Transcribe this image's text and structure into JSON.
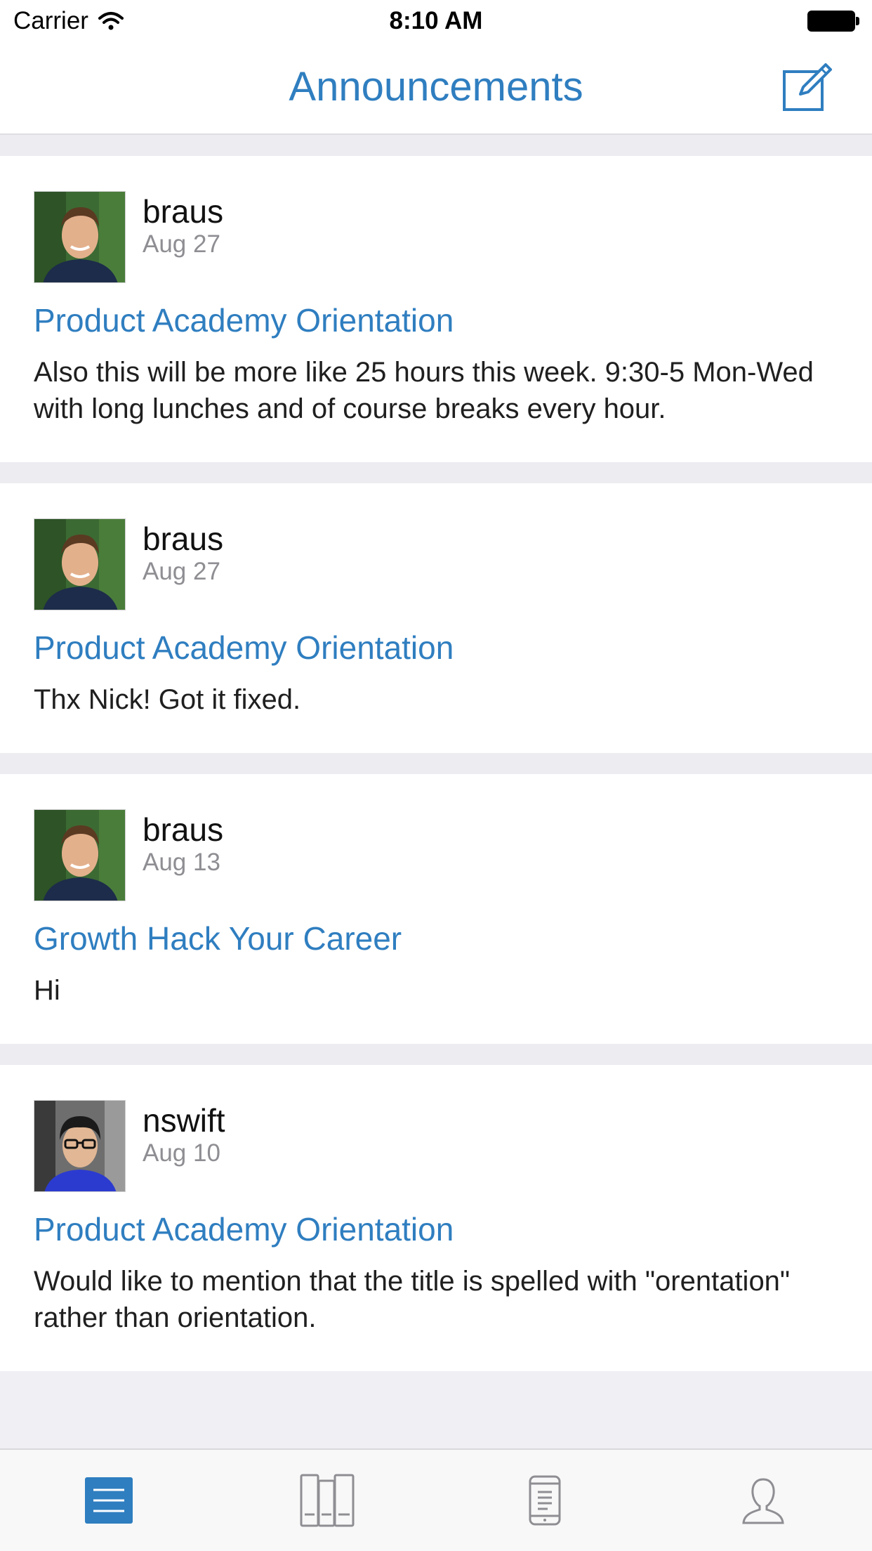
{
  "status_bar": {
    "carrier": "Carrier",
    "time": "8:10 AM"
  },
  "nav": {
    "title": "Announcements",
    "compose_icon": "compose-icon"
  },
  "posts": [
    {
      "author": "braus",
      "date": "Aug 27",
      "title": "Product Academy Orientation",
      "body": "Also this will be more like 25 hours this week. 9:30-5 Mon-Wed with long lunches and of course breaks every hour."
    },
    {
      "author": "braus",
      "date": "Aug 27",
      "title": "Product Academy Orientation",
      "body": "Thx Nick! Got it fixed."
    },
    {
      "author": "braus",
      "date": "Aug 13",
      "title": "Growth Hack Your Career",
      "body": "Hi"
    },
    {
      "author": "nswift",
      "date": "Aug 10",
      "title": "Product Academy Orientation",
      "body": "Would like to mention that the title is spelled with \"orentation\" rather than orientation."
    }
  ],
  "tabs": [
    {
      "icon": "announcements-list-icon",
      "active": true
    },
    {
      "icon": "courses-library-icon",
      "active": false
    },
    {
      "icon": "device-icon",
      "active": false
    },
    {
      "icon": "profile-icon",
      "active": false
    }
  ],
  "colors": {
    "accent": "#2f7ec0",
    "separator": "#ececf1",
    "secondary_text": "#8e8e93",
    "inactive_icon": "#8e8e93"
  }
}
